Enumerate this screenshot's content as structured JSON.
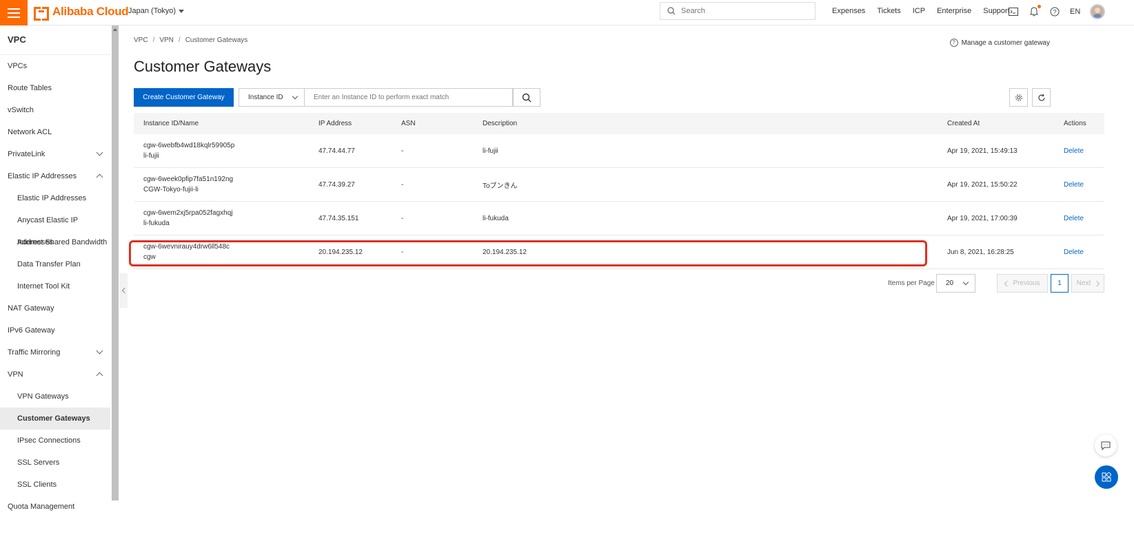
{
  "topbar": {
    "brand": "Alibaba Cloud",
    "region": "Japan (Tokyo)",
    "search_placeholder": "Search",
    "links": [
      "Expenses",
      "Tickets",
      "ICP",
      "Enterprise",
      "Support"
    ],
    "language": "EN",
    "accent_color": "#ff6a00"
  },
  "sidebar": {
    "title": "VPC",
    "items": [
      {
        "label": "VPCs"
      },
      {
        "label": "Route Tables"
      },
      {
        "label": "vSwitch"
      },
      {
        "label": "Network ACL"
      },
      {
        "label": "PrivateLink"
      },
      {
        "label": "Elastic IP Addresses"
      },
      {
        "label": "Elastic IP Addresses"
      },
      {
        "label": "Anycast Elastic IP Addresses"
      },
      {
        "label": "Internet Shared Bandwidth"
      },
      {
        "label": "Data Transfer Plan"
      },
      {
        "label": "Internet Tool Kit"
      },
      {
        "label": "NAT Gateway"
      },
      {
        "label": "IPv6 Gateway"
      },
      {
        "label": "Traffic Mirroring"
      },
      {
        "label": "VPN"
      },
      {
        "label": "VPN Gateways"
      },
      {
        "label": "Customer Gateways"
      },
      {
        "label": "IPsec Connections"
      },
      {
        "label": "SSL Servers"
      },
      {
        "label": "SSL Clients"
      },
      {
        "label": "Quota Management"
      }
    ]
  },
  "breadcrumb": [
    "VPC",
    "VPN",
    "Customer Gateways"
  ],
  "manage_link": "Manage a customer gateway",
  "page_title": "Customer Gateways",
  "toolbar": {
    "create_label": "Create Customer Gateway",
    "filter_field": "Instance ID",
    "search_placeholder": "Enter an Instance ID to perform exact match",
    "primary_color": "#0064c8"
  },
  "table": {
    "headers": {
      "id": "Instance ID/Name",
      "ip": "IP Address",
      "asn": "ASN",
      "desc": "Description",
      "created": "Created At",
      "actions": "Actions"
    },
    "rows": [
      {
        "id": "cgw-6webfb4wd18kqlr59905p",
        "name": "li-fujii",
        "ip": "47.74.44.77",
        "asn": "-",
        "desc": "li-fujii",
        "created": "Apr 19, 2021, 15:49:13",
        "action": "Delete"
      },
      {
        "id": "cgw-6week0pfip7fa51n192ng",
        "name": "CGW-Tokyo-fujii-li",
        "ip": "47.74.39.27",
        "asn": "-",
        "desc": "Toブンきん",
        "created": "Apr 19, 2021, 15:50:22",
        "action": "Delete"
      },
      {
        "id": "cgw-6wem2xj5rpa052fagxhqj",
        "name": "li-fukuda",
        "ip": "47.74.35.151",
        "asn": "-",
        "desc": "li-fukuda",
        "created": "Apr 19, 2021, 17:00:39",
        "action": "Delete"
      },
      {
        "id": "cgw-6wevnirauy4drw6ll548c",
        "name": "cgw",
        "ip": "20.194.235.12",
        "asn": "-",
        "desc": "20.194.235.12",
        "created": "Jun 8, 2021, 16:28:25",
        "action": "Delete"
      }
    ]
  },
  "pagination": {
    "items_per_page_label": "Items per Page",
    "items_per_page": "20",
    "previous": "Previous",
    "current_page": "1",
    "next": "Next"
  },
  "highlight_color": "#e0301e"
}
